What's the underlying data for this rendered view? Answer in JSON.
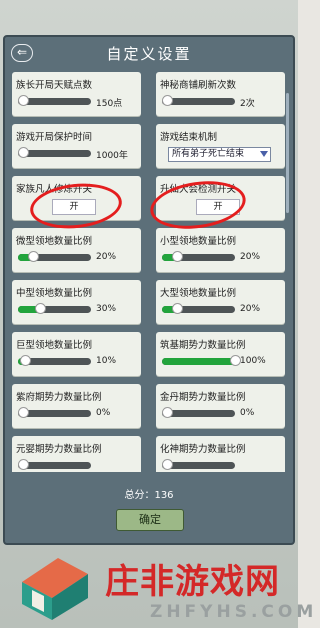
{
  "title": "自定义设置",
  "settings": [
    {
      "label": "族长开局天赋点数",
      "type": "slider",
      "percent": 0.0,
      "value": "150点"
    },
    {
      "label": "神秘商铺刷新次数",
      "type": "slider",
      "percent": 0.0,
      "value": "2次"
    },
    {
      "label": "游戏开局保护时间",
      "type": "slider",
      "percent": 0.0,
      "value": "1000年"
    },
    {
      "label": "游戏结束机制",
      "type": "select",
      "value": "所有弟子死亡结束"
    },
    {
      "label": "家族凡人修炼开关",
      "type": "toggle",
      "value": "开"
    },
    {
      "label": "升仙大会检测开关",
      "type": "toggle",
      "value": "开"
    },
    {
      "label": "微型领地数量比例",
      "type": "slider",
      "percent": 20,
      "value": "20%"
    },
    {
      "label": "小型领地数量比例",
      "type": "slider",
      "percent": 20,
      "value": "20%"
    },
    {
      "label": "中型领地数量比例",
      "type": "slider",
      "percent": 30,
      "value": "30%"
    },
    {
      "label": "大型领地数量比例",
      "type": "slider",
      "percent": 20,
      "value": "20%"
    },
    {
      "label": "巨型领地数量比例",
      "type": "slider",
      "percent": 10,
      "value": "10%"
    },
    {
      "label": "筑基期势力数量比例",
      "type": "slider",
      "percent": 100,
      "value": "100%"
    },
    {
      "label": "紫府期势力数量比例",
      "type": "slider",
      "percent": 0,
      "value": "0%"
    },
    {
      "label": "金丹期势力数量比例",
      "type": "slider",
      "percent": 0,
      "value": "0%"
    },
    {
      "label": "元婴期势力数量比例",
      "type": "slider",
      "percent": 0,
      "value": ""
    },
    {
      "label": "化神期势力数量比例",
      "type": "slider",
      "percent": 0,
      "value": ""
    }
  ],
  "total": "总分：136",
  "confirm_label": "确定",
  "watermark": {
    "title": "庄非游戏网",
    "subtitle": "ZHFYHS.COM"
  },
  "colors": {
    "fill": "#22a43c",
    "annotation": "#e41e1e"
  }
}
